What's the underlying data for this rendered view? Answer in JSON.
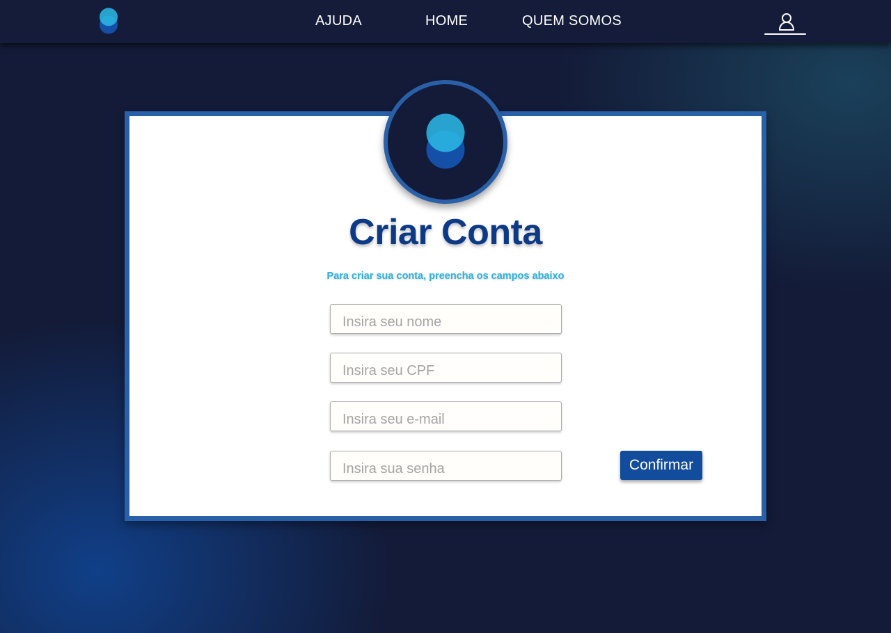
{
  "nav": {
    "logo_icon": "heart-logo-icon",
    "links": [
      "AJUDA",
      "HOME",
      "QUEM SOMOS"
    ],
    "user_icon": "user-icon"
  },
  "card": {
    "avatar_icon": "heart-logo-icon",
    "title": "Criar Conta",
    "subtitle": "Para criar sua conta, preencha os campos abaixo"
  },
  "form": {
    "nome": {
      "placeholder": "Insira seu nome",
      "value": ""
    },
    "cpf": {
      "placeholder": "Insira seu CPF",
      "value": ""
    },
    "email": {
      "placeholder": "Insira seu e-mail",
      "value": ""
    },
    "senha": {
      "placeholder": "Insira sua senha",
      "value": ""
    },
    "confirm_label": "Confirmar"
  },
  "colors": {
    "background": "#131b38",
    "navbar": "#141c3a",
    "card_border": "#2a60a8",
    "title": "#0d3a86",
    "subtitle": "#29b2e2",
    "button": "#124c9c",
    "logo_dark_blue": "#1450a8",
    "logo_light_blue": "#2bb6e4"
  }
}
